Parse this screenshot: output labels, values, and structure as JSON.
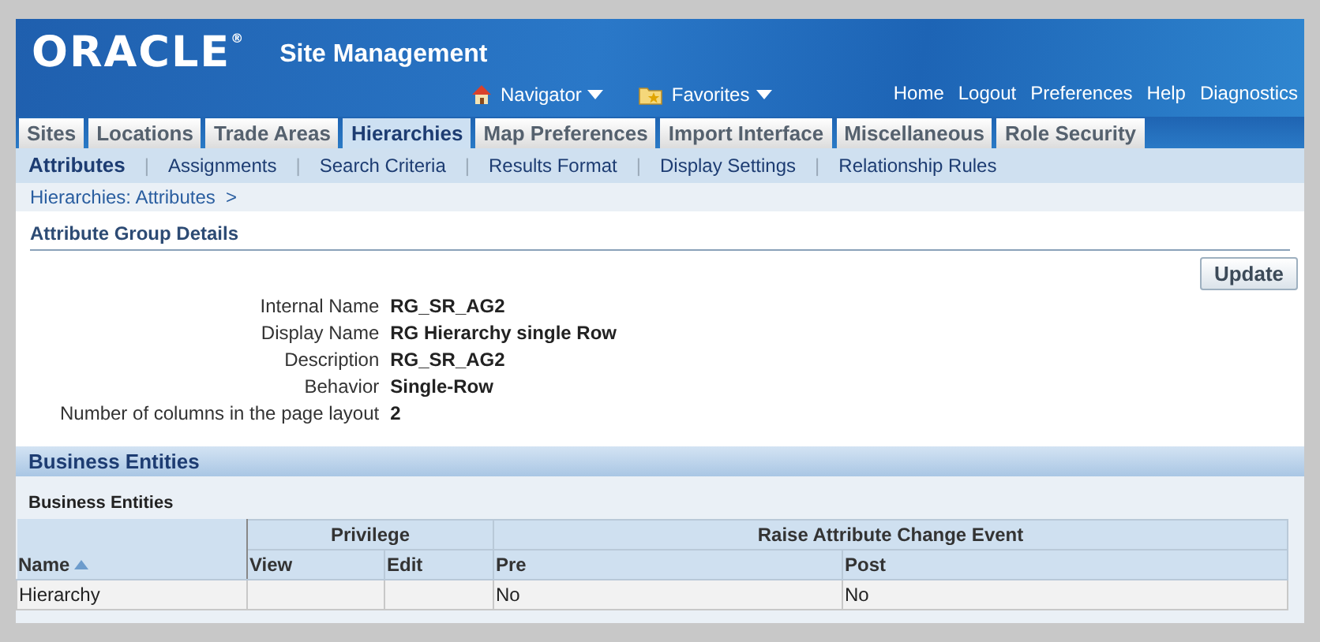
{
  "brand": {
    "logo": "ORACLE",
    "mark": "®",
    "app_title": "Site Management"
  },
  "global_menus": [
    {
      "label": "Navigator",
      "kind": "home"
    },
    {
      "label": "Favorites",
      "kind": "folder"
    }
  ],
  "subtab_separator": "|",
  "global_links": [
    "Home",
    "Logout",
    "Preferences",
    "Help",
    "Diagnostics"
  ],
  "tabs": [
    {
      "label": "Sites",
      "selected": false
    },
    {
      "label": "Locations",
      "selected": false
    },
    {
      "label": "Trade Areas",
      "selected": false
    },
    {
      "label": "Hierarchies",
      "selected": true
    },
    {
      "label": "Map Preferences",
      "selected": false
    },
    {
      "label": "Import Interface",
      "selected": false
    },
    {
      "label": "Miscellaneous",
      "selected": false
    },
    {
      "label": "Role Security",
      "selected": false
    }
  ],
  "subtabs": [
    {
      "label": "Attributes",
      "selected": true
    },
    {
      "label": "Assignments",
      "selected": false
    },
    {
      "label": "Search Criteria",
      "selected": false
    },
    {
      "label": "Results Format",
      "selected": false
    },
    {
      "label": "Display Settings",
      "selected": false
    },
    {
      "label": "Relationship Rules",
      "selected": false
    }
  ],
  "breadcrumb": "Hierarchies: Attributes  >",
  "page_heading": "Attribute Group Details",
  "update_button": "Update",
  "fields": [
    {
      "label": "Internal Name",
      "value": "RG_SR_AG2"
    },
    {
      "label": "Display Name",
      "value": "RG Hierarchy single Row"
    },
    {
      "label": "Description",
      "value": "RG_SR_AG2"
    },
    {
      "label": "Behavior",
      "value": "Single-Row"
    },
    {
      "label": "Number of columns in the page layout",
      "value": "2"
    }
  ],
  "section_heading": "Business Entities",
  "table": {
    "caption": "Business Entities",
    "group_headers": [
      "Privilege",
      "Raise Attribute Change Event"
    ],
    "columns": [
      "Name",
      "View",
      "Edit",
      "Pre",
      "Post"
    ],
    "rows": [
      [
        "Hierarchy",
        "",
        "",
        "No",
        "No"
      ]
    ]
  }
}
